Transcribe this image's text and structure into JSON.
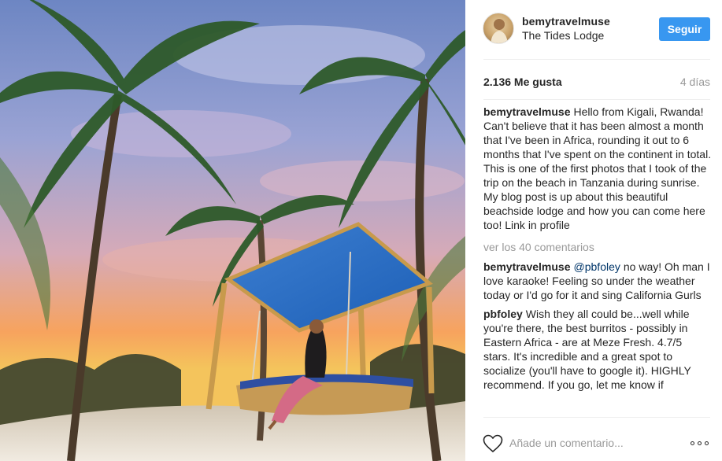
{
  "post": {
    "author": "bemytravelmuse",
    "location": "The Tides Lodge",
    "follow_label": "Seguir",
    "likes": "2.136 Me gusta",
    "time": "4 días",
    "caption": {
      "username": "bemytravelmuse",
      "text": "Hello from Kigali, Rwanda! Can't believe that it has been almost a month that I've been in Africa, rounding it out to 6 months that I've spent on the continent in total. This is one of the first photos that I took of the trip on the beach in Tanzania during sunrise. My blog post is up about this beautiful beachside lodge and how you can come here too! Link in profile"
    },
    "view_all": "ver los 40 comentarios",
    "comments": [
      {
        "username": "bemytravelmuse",
        "mention": "@pbfoley",
        "text": "no way! Oh man I love karaoke! Feeling so under the weather today or I'd go for it and sing California Gurls"
      },
      {
        "username": "pbfoley",
        "mention": "",
        "text": "Wish they all could be...well while you're there, the best burritos - possibly in Eastern Africa - are at Meze Fresh. 4.7/5 stars. It's incredible and a great spot to socialize (you'll have to google it). HIGHLY recommend. If you go, let me know if"
      }
    ],
    "comment_placeholder": "Añade un comentario...",
    "icons": {
      "like": "heart-outline-icon",
      "options": "more-options-icon"
    },
    "colors": {
      "follow_button": "#3897f0",
      "muted_text": "#999999",
      "mention": "#003569"
    }
  }
}
